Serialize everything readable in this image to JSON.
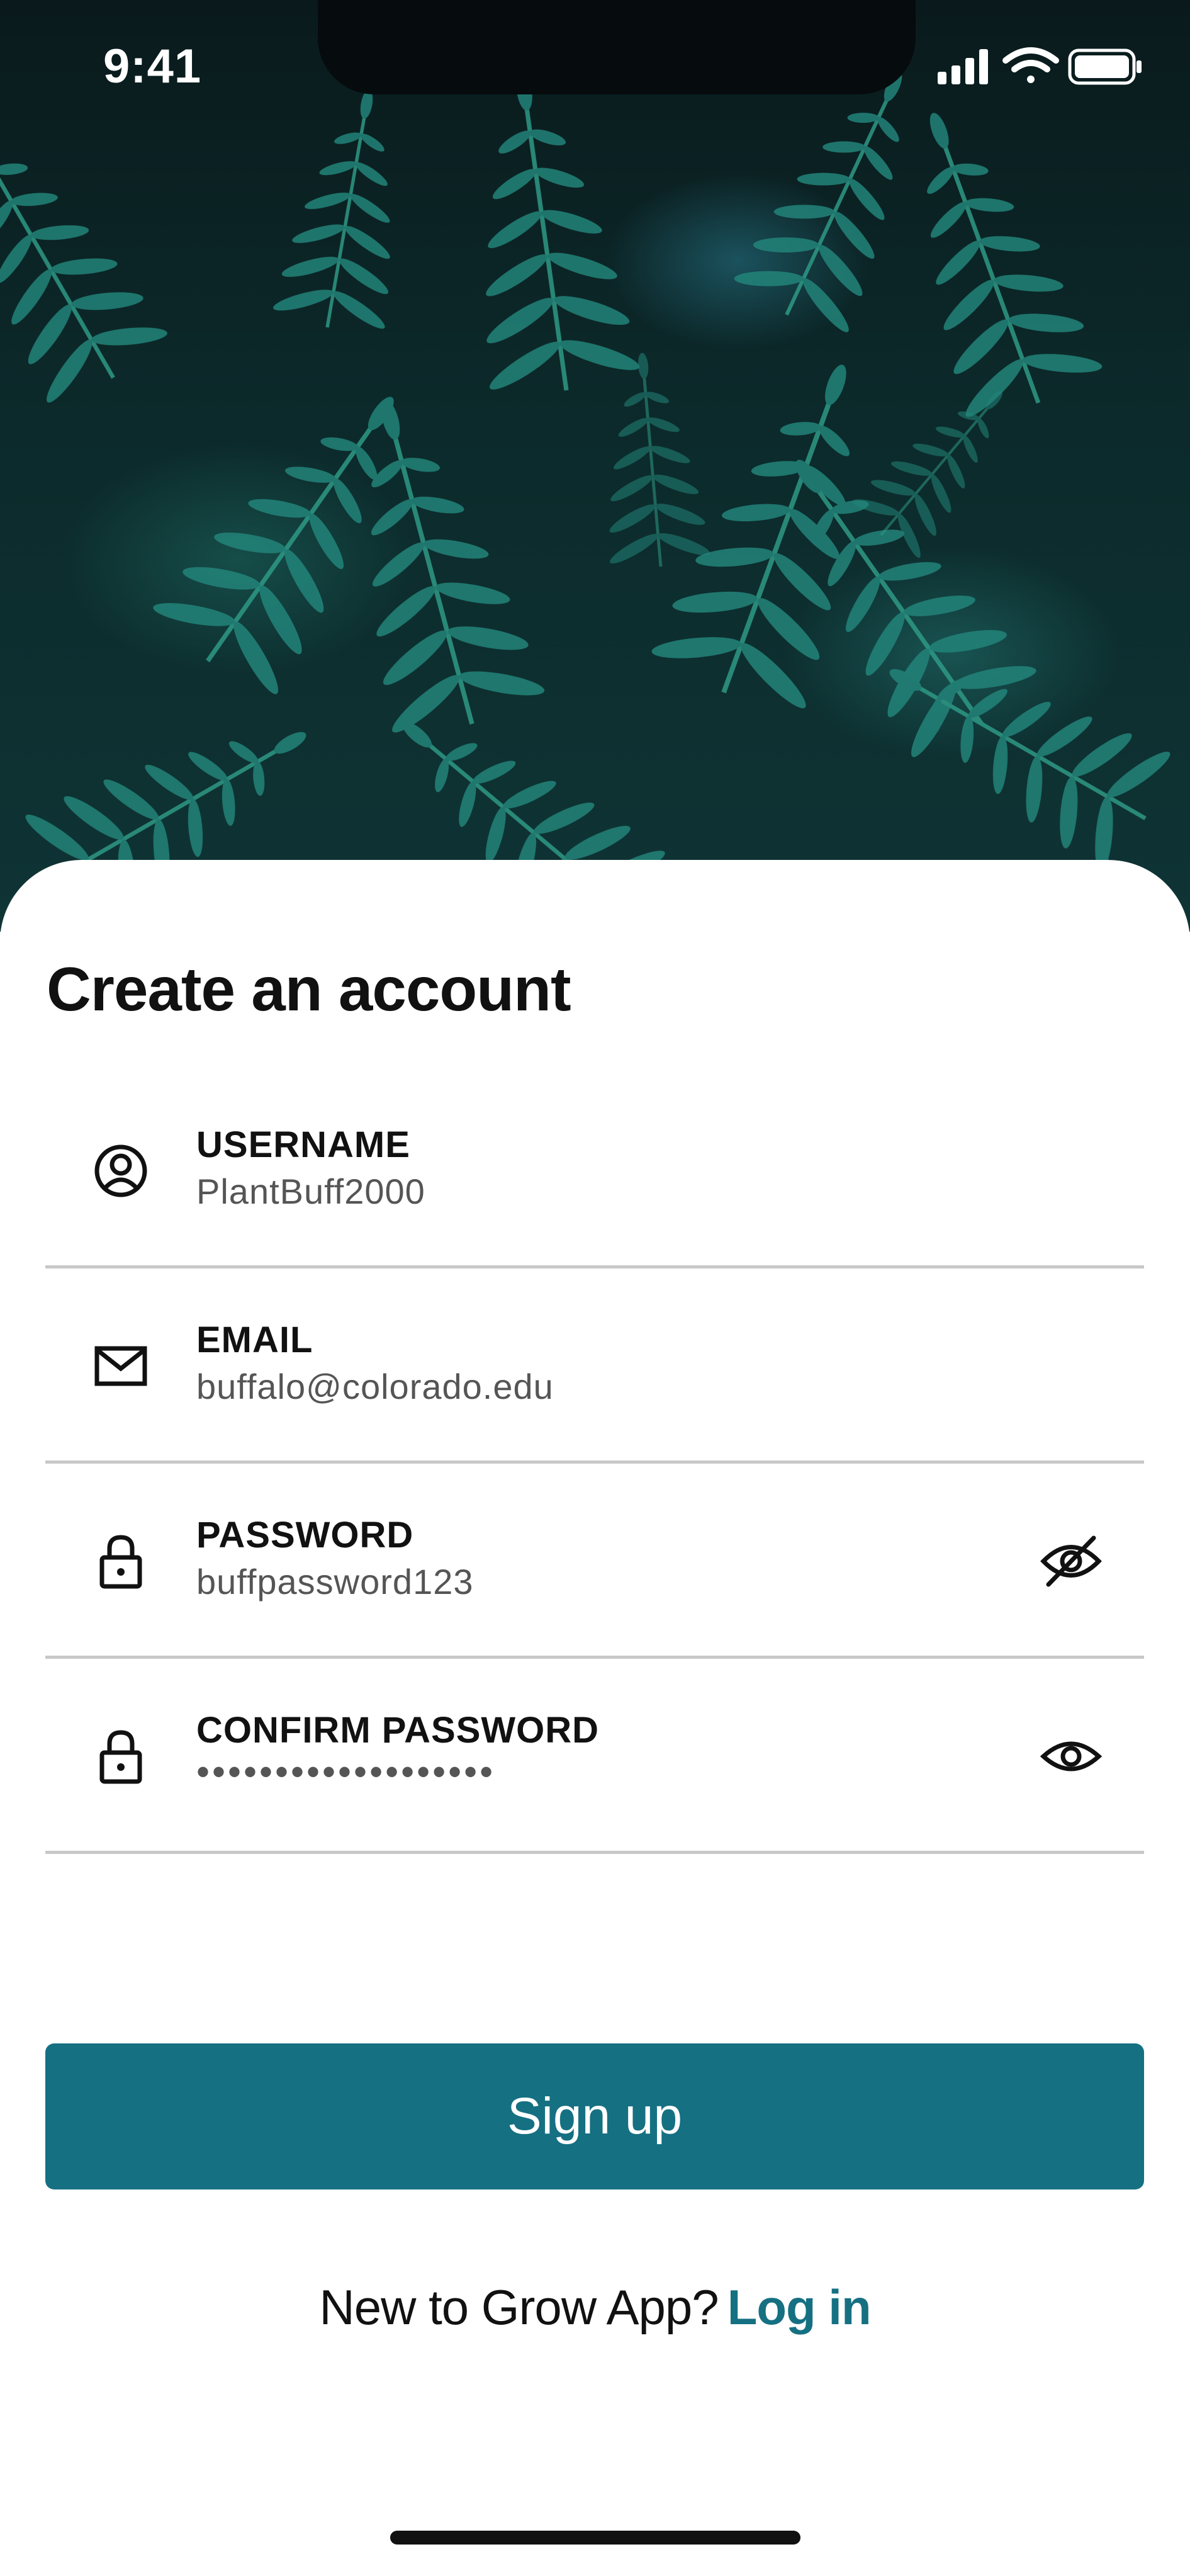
{
  "status_bar": {
    "time": "9:41"
  },
  "icons": {
    "signal": "cellular-signal-icon",
    "wifi": "wifi-icon",
    "battery": "battery-icon",
    "username": "user-circle-icon",
    "email": "envelope-icon",
    "password": "lock-icon",
    "confirm_password": "lock-icon",
    "password_toggle": "eye-off-icon",
    "confirm_toggle": "eye-icon"
  },
  "form": {
    "title": "Create an account",
    "fields": [
      {
        "label": "USERNAME",
        "value": "PlantBuff2000"
      },
      {
        "label": "EMAIL",
        "value": "buffalo@colorado.edu"
      },
      {
        "label": "PASSWORD",
        "value": "buffpassword123"
      },
      {
        "label": "CONFIRM PASSWORD",
        "value": "•••••••••••••••••••"
      }
    ],
    "submit_label": "Sign up"
  },
  "footer": {
    "prompt": "New to Grow App?",
    "link_label": "Log in"
  },
  "colors": {
    "accent": "#157082",
    "divider": "#c8c8c8",
    "hero_dark": "#0a1a1c",
    "fern": "#1f7a72"
  }
}
